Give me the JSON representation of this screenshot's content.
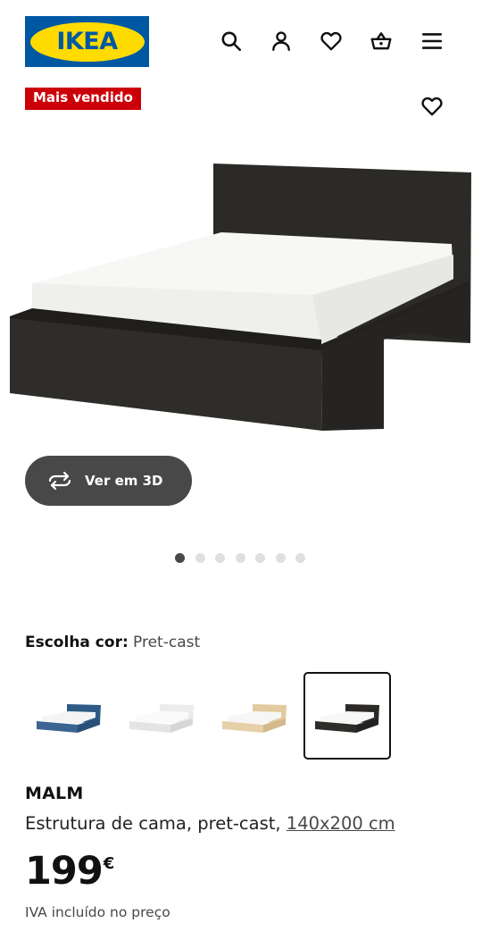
{
  "header": {
    "logo_text": "IKEA",
    "icons": [
      "search-icon",
      "user-icon",
      "heart-icon",
      "basket-icon",
      "menu-icon"
    ]
  },
  "badge": {
    "label": "Mais vendido",
    "color": "#cc0008"
  },
  "brand_colors": {
    "blue": "#0058a3",
    "yellow": "#ffdb00"
  },
  "carousel": {
    "total": 7,
    "active_index": 0
  },
  "view_3d": {
    "label": "Ver em 3D"
  },
  "color_selector": {
    "label": "Escolha cor:",
    "value": "Pret-cast",
    "options": [
      "azul",
      "branco",
      "folheado carvalho",
      "pret-cast"
    ],
    "selected_index": 3
  },
  "product": {
    "name": "MALM",
    "description": "Estrutura de cama, pret-cast,",
    "size": "140x200 cm",
    "price": "199",
    "currency": "€",
    "vat_note": "IVA incluído no preço"
  }
}
